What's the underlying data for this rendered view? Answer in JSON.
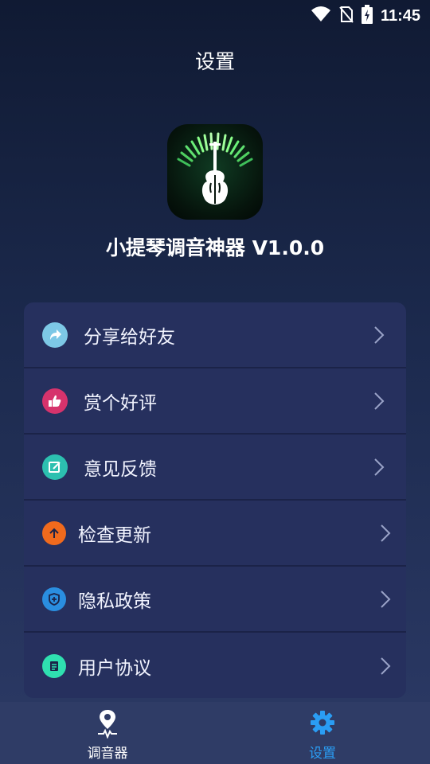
{
  "status_bar": {
    "time": "11:45",
    "icons": [
      "wifi-icon",
      "no-sim-icon",
      "battery-charging-icon"
    ]
  },
  "header": {
    "title": "设置"
  },
  "app": {
    "name": "小提琴调音神器 V1.0.0",
    "logo": "violin-tuner-logo"
  },
  "menu": {
    "items": [
      {
        "label": "分享给好友",
        "icon": "share-icon",
        "color": "#7dc8e6"
      },
      {
        "label": "赏个好评",
        "icon": "thumbs-up-icon",
        "color": "#d6336c"
      },
      {
        "label": "意见反馈",
        "icon": "feedback-edit-icon",
        "color": "#2cc0b0"
      },
      {
        "label": "检查更新",
        "icon": "update-arrow-icon",
        "color": "#f06a1d"
      },
      {
        "label": "隐私政策",
        "icon": "privacy-shield-icon",
        "color": "#2a8ee0"
      },
      {
        "label": "用户协议",
        "icon": "agreement-doc-icon",
        "color": "#2fe0b0"
      }
    ]
  },
  "bottom_nav": {
    "tabs": [
      {
        "label": "调音器",
        "icon": "tuner-pin-icon",
        "active": false
      },
      {
        "label": "设置",
        "icon": "settings-gear-icon",
        "active": true
      }
    ]
  },
  "colors": {
    "accent": "#2a9df4",
    "card": "#26305e",
    "nav_bg": "#2f3c66"
  }
}
